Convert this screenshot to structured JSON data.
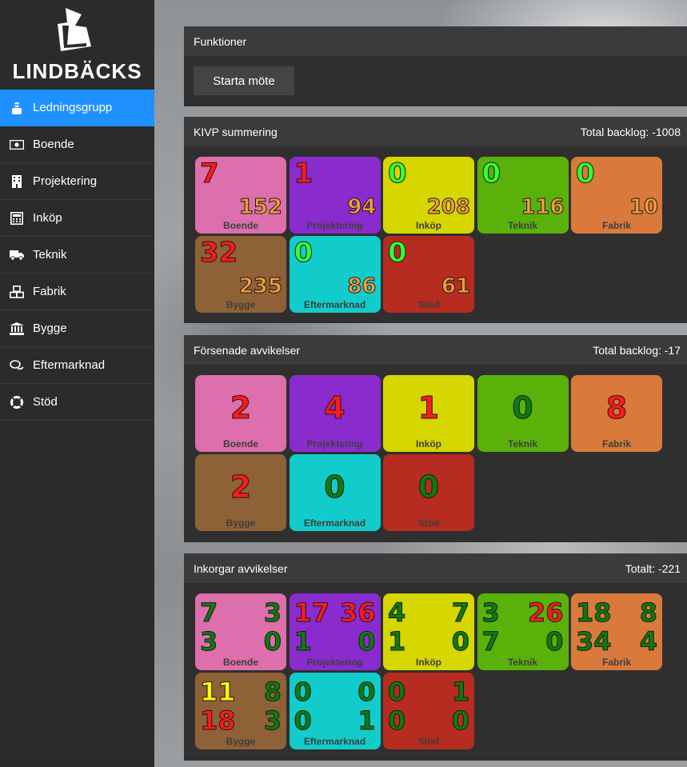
{
  "sidebar": {
    "brand": "LINDBÄCKS",
    "items": [
      {
        "label": "Ledningsgrupp",
        "icon": "user-secret-icon",
        "active": true
      },
      {
        "label": "Boende",
        "icon": "money-bill-icon"
      },
      {
        "label": "Projektering",
        "icon": "building-icon"
      },
      {
        "label": "Inköp",
        "icon": "calculator-icon"
      },
      {
        "label": "Teknik",
        "icon": "truck-icon"
      },
      {
        "label": "Fabrik",
        "icon": "cubes-icon"
      },
      {
        "label": "Bygge",
        "icon": "landmark-icon"
      },
      {
        "label": "Eftermarknad",
        "icon": "comments-icon"
      },
      {
        "label": "Stöd",
        "icon": "life-ring-icon"
      }
    ]
  },
  "colors": {
    "accent": "#1e90ff",
    "boende": "#dd6fac",
    "projektering": "#8a2bce",
    "inkop": "#d6d600",
    "teknik": "#5ab10a",
    "fabrik": "#d97a3c",
    "bygge": "#8f6136",
    "eftermarknad": "#12cccc",
    "stod": "#b62c20",
    "num_red": "#ff1a1a",
    "num_green": "#0f7a0f",
    "num_lime": "#33ff33",
    "num_orange": "#f39c3a",
    "num_yellow": "#ffff00"
  },
  "funktioner": {
    "title": "Funktioner",
    "start_button": "Starta möte"
  },
  "kivp": {
    "title": "KIVP summering",
    "backlog": "Total backlog: -1008",
    "tiles": [
      {
        "label": "Boende",
        "a": "7",
        "b": "152",
        "a_color": "#ff1a1a"
      },
      {
        "label": "Projektering",
        "a": "1",
        "b": "94",
        "a_color": "#ff1a1a"
      },
      {
        "label": "Inköp",
        "a": "0",
        "b": "208",
        "a_color": "#33ff33"
      },
      {
        "label": "Teknik",
        "a": "0",
        "b": "116",
        "a_color": "#33ff33"
      },
      {
        "label": "Fabrik",
        "a": "0",
        "b": "10",
        "a_color": "#33ff33"
      },
      {
        "label": "Bygge",
        "a": "32",
        "b": "235",
        "a_color": "#ff1a1a"
      },
      {
        "label": "Eftermarknad",
        "a": "0",
        "b": "86",
        "a_color": "#33ff33"
      },
      {
        "label": "Stöd",
        "a": "0",
        "b": "61",
        "a_color": "#33ff33"
      }
    ]
  },
  "forsenade": {
    "title": "Försenade avvikelser",
    "backlog": "Total backlog: -17",
    "tiles": [
      {
        "label": "Boende",
        "n": "2",
        "color": "#ff1a1a"
      },
      {
        "label": "Projektering",
        "n": "4",
        "color": "#ff1a1a"
      },
      {
        "label": "Inköp",
        "n": "1",
        "color": "#ff1a1a"
      },
      {
        "label": "Teknik",
        "n": "0",
        "color": "#0f7a0f"
      },
      {
        "label": "Fabrik",
        "n": "8",
        "color": "#ff1a1a"
      },
      {
        "label": "Bygge",
        "n": "2",
        "color": "#ff1a1a"
      },
      {
        "label": "Eftermarknad",
        "n": "0",
        "color": "#0f7a0f"
      },
      {
        "label": "Stöd",
        "n": "0",
        "color": "#0f7a0f"
      }
    ]
  },
  "inkorgar": {
    "title": "Inkorgar avvikelser",
    "total": "Totalt: -221",
    "tiles": [
      {
        "label": "Boende",
        "tl": "7",
        "tr": "3",
        "bl": "3",
        "br": "0",
        "c": [
          "#0f7a0f",
          "#0f7a0f",
          "#0f7a0f",
          "#0f7a0f"
        ]
      },
      {
        "label": "Projektering",
        "tl": "17",
        "tr": "36",
        "bl": "1",
        "br": "0",
        "c": [
          "#ff1a1a",
          "#ff1a1a",
          "#0f7a0f",
          "#0f7a0f"
        ]
      },
      {
        "label": "Inköp",
        "tl": "4",
        "tr": "7",
        "bl": "1",
        "br": "0",
        "c": [
          "#0f7a0f",
          "#0f7a0f",
          "#0f7a0f",
          "#0f7a0f"
        ]
      },
      {
        "label": "Teknik",
        "tl": "3",
        "tr": "26",
        "bl": "7",
        "br": "0",
        "c": [
          "#0f7a0f",
          "#ff1a1a",
          "#0f7a0f",
          "#0f7a0f"
        ]
      },
      {
        "label": "Fabrik",
        "tl": "18",
        "tr": "8",
        "bl": "34",
        "br": "4",
        "c": [
          "#0f7a0f",
          "#0f7a0f",
          "#0f7a0f",
          "#0f7a0f"
        ]
      },
      {
        "label": "Bygge",
        "tl": "11",
        "tr": "8",
        "bl": "18",
        "br": "3",
        "c": [
          "#ffff00",
          "#0f7a0f",
          "#ff1a1a",
          "#0f7a0f"
        ]
      },
      {
        "label": "Eftermarknad",
        "tl": "0",
        "tr": "0",
        "bl": "0",
        "br": "1",
        "c": [
          "#0f7a0f",
          "#0f7a0f",
          "#0f7a0f",
          "#0f7a0f"
        ]
      },
      {
        "label": "Stöd",
        "tl": "0",
        "tr": "1",
        "bl": "0",
        "br": "0",
        "c": [
          "#0f7a0f",
          "#0f7a0f",
          "#0f7a0f",
          "#0f7a0f"
        ]
      }
    ]
  }
}
